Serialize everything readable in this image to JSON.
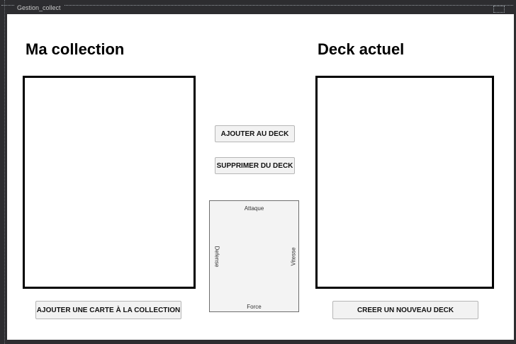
{
  "window": {
    "title": "Gestion_collect"
  },
  "collection": {
    "heading": "Ma collection",
    "add_card_button": "AJOUTER UNE CARTE À LA COLLECTION"
  },
  "deck": {
    "heading": "Deck actuel",
    "new_deck_button": "CREER UN NOUVEAU DECK"
  },
  "actions": {
    "add_to_deck": "AJOUTER AU DECK",
    "remove_from_deck": "SUPPRIMER DU DECK"
  },
  "card_preview": {
    "top_label": "Attaque",
    "left_label": "Defense",
    "right_label": "Vitesse",
    "bottom_label": "Force"
  }
}
